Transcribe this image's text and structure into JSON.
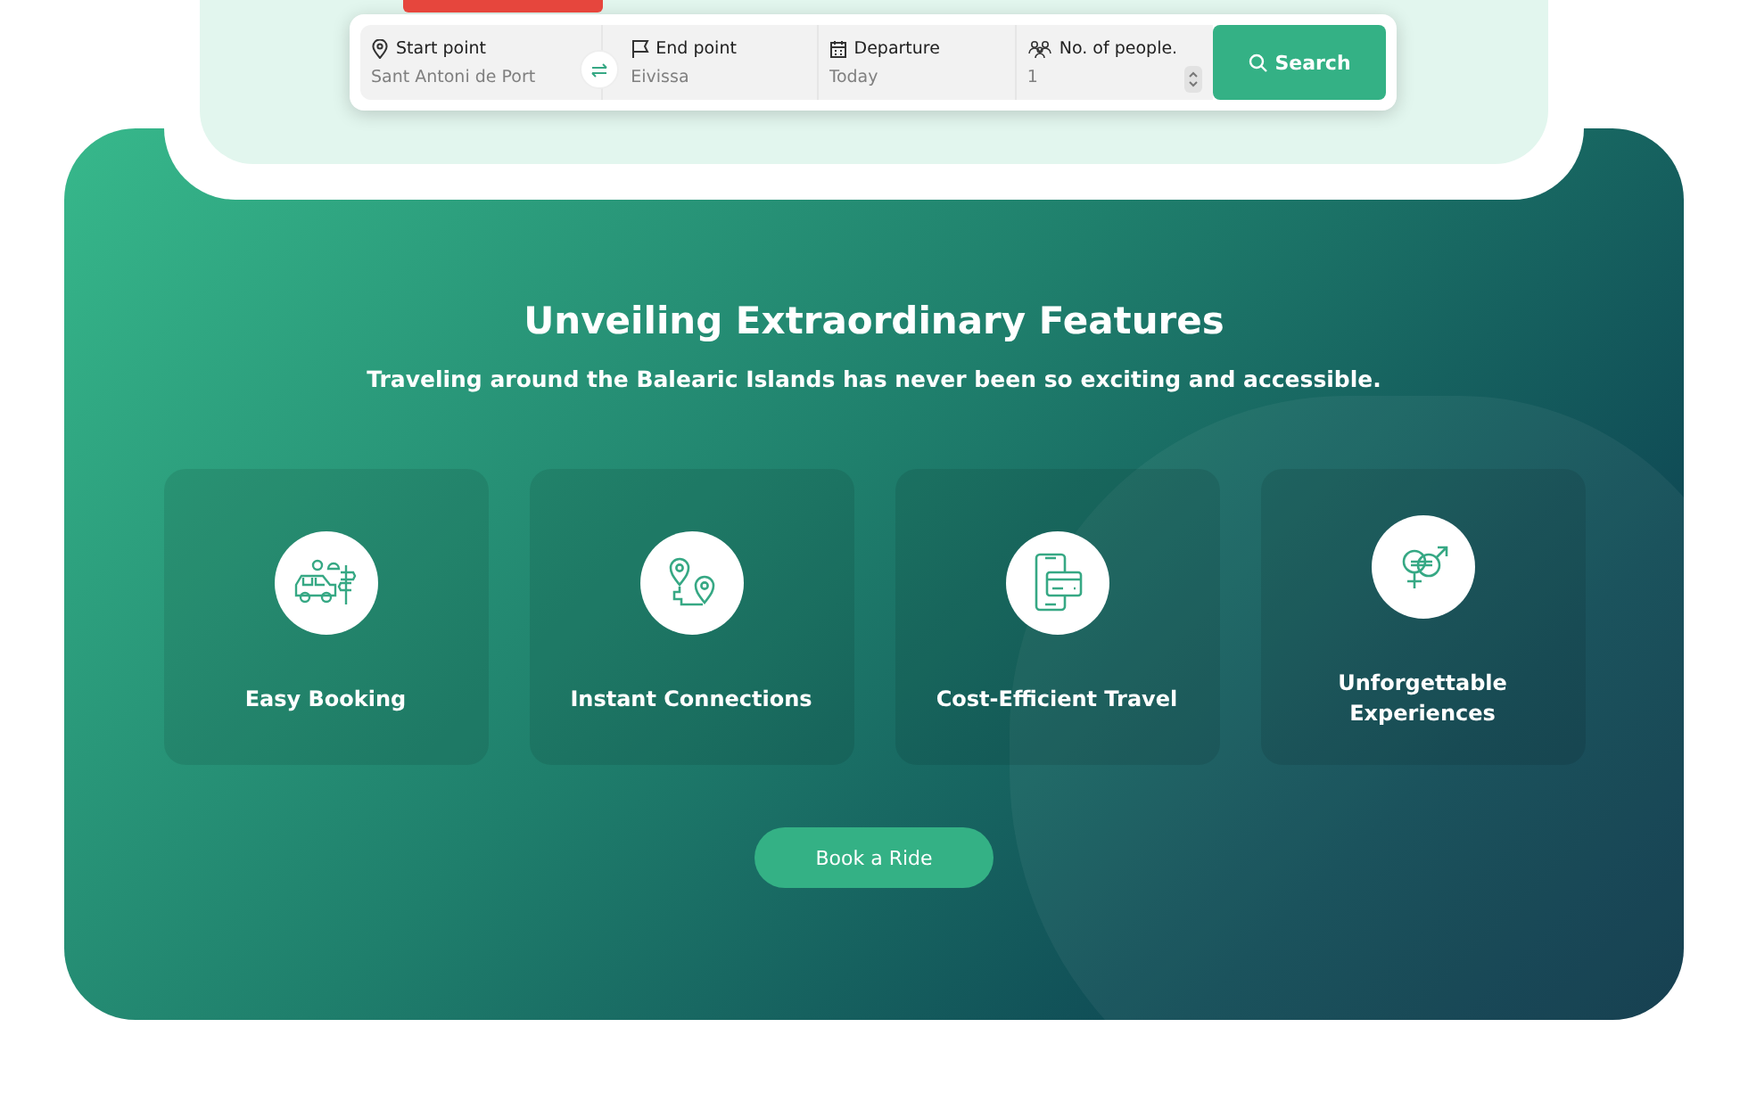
{
  "search_bar": {
    "fields": [
      {
        "kind": "text",
        "label": "Start point",
        "placeholder": "Sant Antoni de Port"
      },
      {
        "kind": "text",
        "label": "End point",
        "placeholder": "Eivissa"
      },
      {
        "kind": "date",
        "label": "Departure",
        "placeholder": "Today"
      },
      {
        "kind": "number",
        "label": "No. of people.",
        "placeholder": "1"
      }
    ],
    "button": "Search"
  },
  "features": {
    "title": "Unveiling Extraordinary Features",
    "subtitle": "Traveling around the Balearic Islands has never been so exciting and accessible.",
    "cards": [
      {
        "kind": "booking",
        "label": "Easy Booking"
      },
      {
        "kind": "route",
        "label": "Instant Connections"
      },
      {
        "kind": "payment",
        "label": "Cost-Efficient Travel"
      },
      {
        "kind": "experience",
        "label": "Unforgettable Experiences"
      }
    ],
    "button": "Book a Ride"
  }
}
